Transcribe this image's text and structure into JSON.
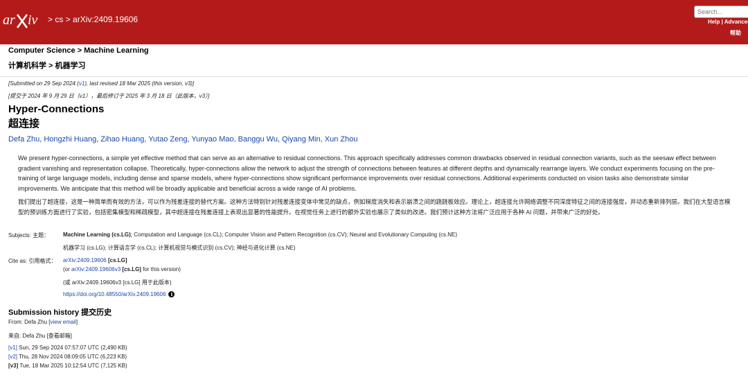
{
  "header": {
    "logo_alt": "arXiv",
    "breadcrumb": [
      "cs",
      "arXiv:2409.19606"
    ],
    "search_placeholder": "Search...",
    "links": [
      "Help",
      "Advanced"
    ],
    "links_cn": "帮助"
  },
  "subheader": {
    "category": "Computer Science > Machine Learning",
    "category_cn": "计算机科学 > 机器学习"
  },
  "submitted": {
    "prefix": "[Submitted on 29 Sep 2024 (",
    "v1_link": "v1",
    "suffix": "), last revised 18 Mar 2025 (this version, v3)]",
    "cn": "[提交于 2024 年 9 月 29 日（v1），最后修订于 2025 年 3 月 18 日（此版本，v3）]"
  },
  "paper": {
    "title": "Hyper-Connections",
    "title_cn": "超连接",
    "authors": "Defa Zhu, Hongzhi Huang, Zihao Huang, Yutao Zeng, Yunyao Mao, Banggu Wu, Qiyang Min, Xun Zhou",
    "abstract": "We present hyper-connections, a simple yet effective method that can serve as an alternative to residual connections. This approach specifically addresses common drawbacks observed in residual connection variants, such as the seesaw effect between gradient vanishing and representation collapse. Theoretically, hyper-connections allow the network to adjust the strength of connections between features at different depths and dynamically rearrange layers. We conduct experiments focusing on the pre-training of large language models, including dense and sparse models, where hyper-connections show significant performance improvements over residual connections. Additional experiments conducted on vision tasks also demonstrate similar improvements. We anticipate that this method will be broadly applicable and beneficial across a wide range of AI problems.",
    "abstract_cn": "我们提出了超连接，这是一种简单而有效的方法，可以作为残差连接的替代方案。这种方法特别针对残差连接变体中常见的缺点，例如梯度消失和表示崩溃之间的跷跷板效应。理论上，超连接允许网络调整不同深度特征之间的连接强度，并动态重新排列层。我们在大型语言模型的预训练方面进行了实验，包括密集模型和稀疏模型，其中超连接在残差连接上表现出显著的性能提升。在视觉任务上进行的额外实验也展示了类似的改进。我们预计这种方法将广泛应用于各种 AI 问题，并带来广泛的好处。"
  },
  "subjects": {
    "label": "Subjects:  主题：",
    "primary": "Machine Learning (cs.LG)",
    "rest": "; Computation and Language (cs.CL); Computer Vision and Pattern Recognition (cs.CV); Neural and Evolutionary Computing (cs.NE)",
    "cn": "机器学习 (cs.LG); 计算语言学 (cs.CL); 计算机视觉与模式识别 (cs.CV); 神经与进化计算 (cs.NE)"
  },
  "cite": {
    "label": "Cite as:  引用格式：",
    "id": "arXiv:2409.19606",
    "tag": "[cs.LG]",
    "version_prefix": "(or ",
    "version_id": "arXiv:2409.19606v3",
    "version_tag": "[cs.LG]",
    "version_suffix": " for this version)",
    "cn": "(或 arXiv:2409.19606v3 [cs.LG] 用于此版本)",
    "doi": "https://doi.org/10.48550/arXiv.2409.19606"
  },
  "history": {
    "title": "Submission history  提交历史",
    "from_prefix": "From: Defa Zhu [",
    "view_email": "view email",
    "from_suffix": "]",
    "from_cn": "来自: Defa Zhu [查看邮箱]",
    "versions": [
      {
        "tag": "[v1]",
        "text": " Sun, 29 Sep 2024 07:57:07 UTC (2,490 KB)",
        "link": true
      },
      {
        "tag": "[v2]",
        "text": " Thu, 28 Nov 2024 08:09:05 UTC (6,223 KB)",
        "link": true
      },
      {
        "tag": "[v3]",
        "text": " Tue, 18 Mar 2025 10:12:54 UTC (7,125 KB)",
        "link": false
      }
    ]
  },
  "colors": {
    "header_bg": "#b31b1b",
    "link": "#1a47a8"
  }
}
